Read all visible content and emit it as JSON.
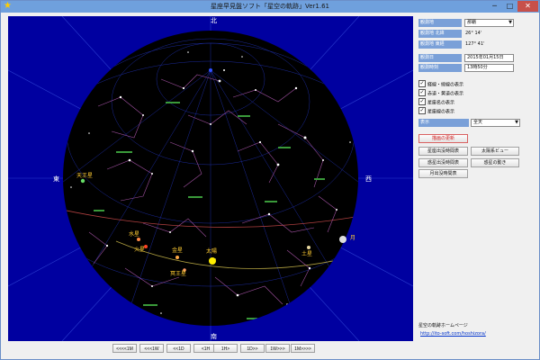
{
  "window": {
    "title": "星座早見盤ソフト「星空の軌跡」Ver1.61",
    "controls": {
      "minimize": "─",
      "maximize": "□",
      "close": "✕"
    },
    "app_icon": "star-icon"
  },
  "sky": {
    "background_color": "#0000a0",
    "disc_color": "#000000",
    "directions": {
      "north": "北",
      "south": "南",
      "east": "東",
      "west": "西"
    },
    "planets": [
      {
        "label": "天王星",
        "icon": "green-dot"
      },
      {
        "label": "水星",
        "icon": "orange-dot"
      },
      {
        "label": "火星",
        "icon": "red-dot"
      },
      {
        "label": "金星",
        "icon": "orange-dot"
      },
      {
        "label": "太陽",
        "icon": "yellow-sun"
      },
      {
        "label": "冥王星",
        "icon": "orange-dot"
      },
      {
        "label": "土星",
        "icon": "saturn-icon"
      },
      {
        "label": "月",
        "icon": "moon-icon"
      }
    ]
  },
  "timebar": {
    "buttons": [
      "<<<<1M",
      "<<<1W",
      "<<1D",
      "<1H",
      "1H>",
      "1D>>",
      "1W>>>",
      "1M>>>>"
    ]
  },
  "panel": {
    "location_label": "観測地",
    "location_value": "那覇",
    "latitude_label": "観測地 北緯",
    "latitude_value": "26° 14'",
    "longitude_label": "観測地 東経",
    "longitude_value": "127° 41'",
    "date_label": "観測日",
    "date_value": "2015年01月15日",
    "time_label": "観測時刻",
    "time_value": "13時50分",
    "checkboxes": [
      {
        "label": "経線・緯線の表示",
        "checked": true
      },
      {
        "label": "赤道・黄道の表示",
        "checked": true
      },
      {
        "label": "星座名の表示",
        "checked": true
      },
      {
        "label": "星座線の表示",
        "checked": true
      }
    ],
    "display_label": "表示",
    "display_value": "全天",
    "update_button": "描画の更新",
    "buttons": {
      "constellation_rise_set": "星座出没時間表",
      "solar_system_view": "太陽系ビュー",
      "planet_rise_set": "惑星出没時間表",
      "planet_motion": "惑星の動き",
      "moon_rise_set": "月出没時間表"
    },
    "homepage_title": "星空の軌跡ホームページ",
    "homepage_url": "http://ito-soft.com/hoshizora/"
  }
}
